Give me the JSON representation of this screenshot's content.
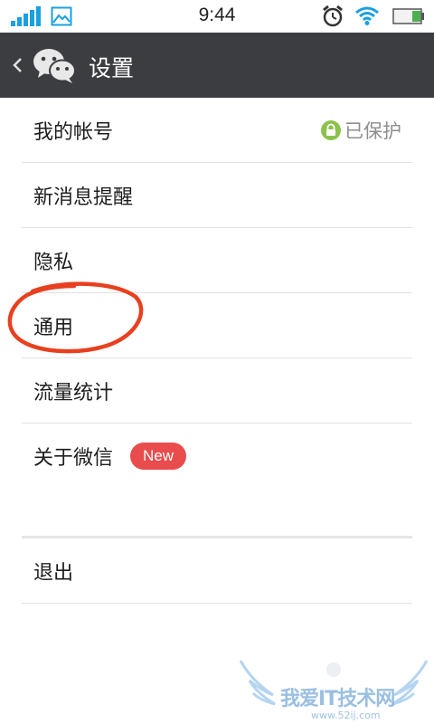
{
  "status_bar": {
    "time": "9:44"
  },
  "header": {
    "title": "设置",
    "icons": [
      "back-chevron-icon",
      "wechat-logo-icon"
    ],
    "background": "#3b3d40"
  },
  "settings": {
    "items": [
      {
        "label": "我的帐号",
        "status": "已保护",
        "status_icon": "lock-icon"
      },
      {
        "label": "新消息提醒"
      },
      {
        "label": "隐私"
      },
      {
        "label": "通用"
      },
      {
        "label": "流量统计"
      },
      {
        "label": "关于微信",
        "badge": "New"
      }
    ],
    "logout_label": "退出"
  },
  "annotation": {
    "target": "通用",
    "color": "#e8401f"
  },
  "watermark": {
    "text": "我爱IT技术网",
    "url": "www.52ij.com"
  },
  "colors": {
    "badge": "#e84c4c",
    "lock": "#8bc34a",
    "wifi": "#1aa0e0",
    "signal": "#1aa0e0"
  }
}
